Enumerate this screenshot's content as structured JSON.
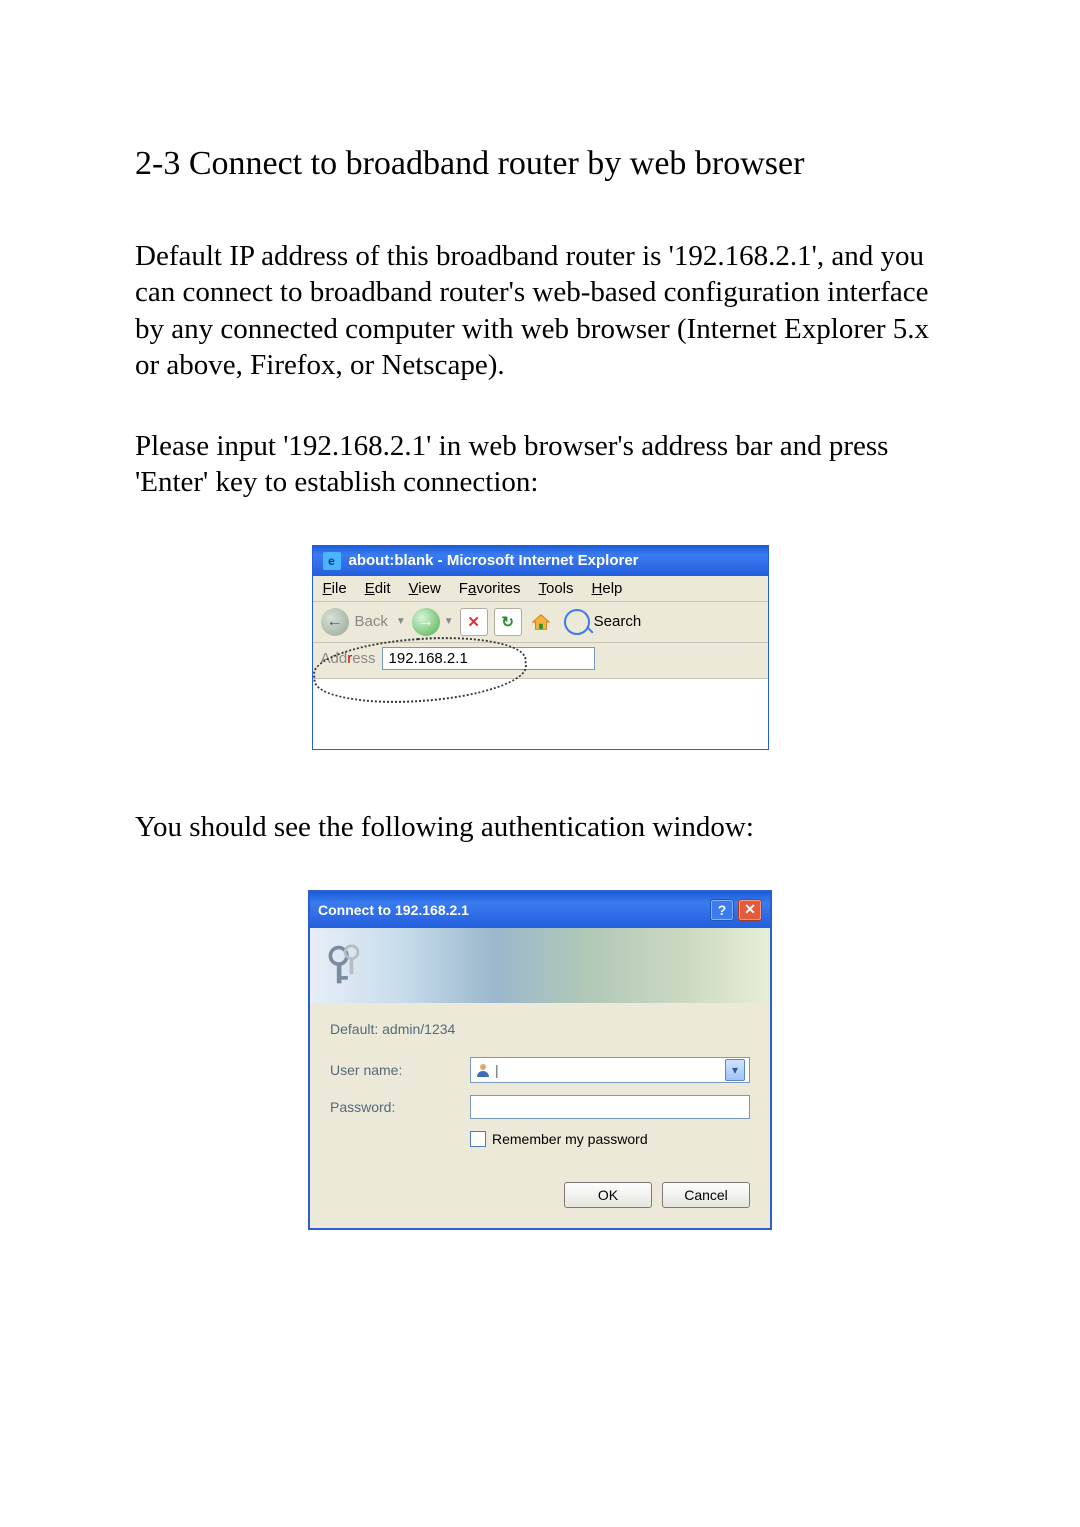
{
  "heading": "2-3 Connect to broadband router by web browser",
  "para1": "Default IP address of this broadband router is '192.168.2.1', and you can connect to broadband router's web-based configuration interface by any connected computer with web browser (Internet Explorer 5.x or above, Firefox, or Netscape).",
  "para2": "Please input '192.168.2.1' in web browser's address bar and press 'Enter' key to establish connection:",
  "para3": "You should see the following authentication window:",
  "ie": {
    "title": "about:blank - Microsoft Internet Explorer",
    "menu": {
      "file": "File",
      "edit": "Edit",
      "view": "View",
      "favorites": "Favorites",
      "tools": "Tools",
      "help": "Help"
    },
    "back_label": "Back",
    "search_label": "Search",
    "address_label": "Address",
    "address_value": "192.168.2.1"
  },
  "auth": {
    "title": "Connect to 192.168.2.1",
    "hint": "Default: admin/1234",
    "username_label": "User name:",
    "password_label": "Password:",
    "remember_label": "Remember my password",
    "ok_label": "OK",
    "cancel_label": "Cancel"
  }
}
